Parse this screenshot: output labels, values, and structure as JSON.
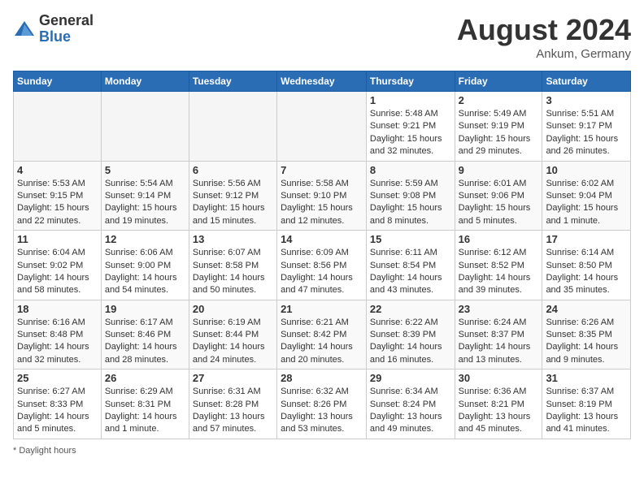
{
  "header": {
    "logo_general": "General",
    "logo_blue": "Blue",
    "month_title": "August 2024",
    "location": "Ankum, Germany"
  },
  "weekdays": [
    "Sunday",
    "Monday",
    "Tuesday",
    "Wednesday",
    "Thursday",
    "Friday",
    "Saturday"
  ],
  "weeks": [
    [
      {
        "day": "",
        "empty": true
      },
      {
        "day": "",
        "empty": true
      },
      {
        "day": "",
        "empty": true
      },
      {
        "day": "",
        "empty": true
      },
      {
        "day": "1",
        "sunrise": "5:48 AM",
        "sunset": "9:21 PM",
        "daylight": "15 hours and 32 minutes."
      },
      {
        "day": "2",
        "sunrise": "5:49 AM",
        "sunset": "9:19 PM",
        "daylight": "15 hours and 29 minutes."
      },
      {
        "day": "3",
        "sunrise": "5:51 AM",
        "sunset": "9:17 PM",
        "daylight": "15 hours and 26 minutes."
      }
    ],
    [
      {
        "day": "4",
        "sunrise": "5:53 AM",
        "sunset": "9:15 PM",
        "daylight": "15 hours and 22 minutes."
      },
      {
        "day": "5",
        "sunrise": "5:54 AM",
        "sunset": "9:14 PM",
        "daylight": "15 hours and 19 minutes."
      },
      {
        "day": "6",
        "sunrise": "5:56 AM",
        "sunset": "9:12 PM",
        "daylight": "15 hours and 15 minutes."
      },
      {
        "day": "7",
        "sunrise": "5:58 AM",
        "sunset": "9:10 PM",
        "daylight": "15 hours and 12 minutes."
      },
      {
        "day": "8",
        "sunrise": "5:59 AM",
        "sunset": "9:08 PM",
        "daylight": "15 hours and 8 minutes."
      },
      {
        "day": "9",
        "sunrise": "6:01 AM",
        "sunset": "9:06 PM",
        "daylight": "15 hours and 5 minutes."
      },
      {
        "day": "10",
        "sunrise": "6:02 AM",
        "sunset": "9:04 PM",
        "daylight": "15 hours and 1 minute."
      }
    ],
    [
      {
        "day": "11",
        "sunrise": "6:04 AM",
        "sunset": "9:02 PM",
        "daylight": "14 hours and 58 minutes."
      },
      {
        "day": "12",
        "sunrise": "6:06 AM",
        "sunset": "9:00 PM",
        "daylight": "14 hours and 54 minutes."
      },
      {
        "day": "13",
        "sunrise": "6:07 AM",
        "sunset": "8:58 PM",
        "daylight": "14 hours and 50 minutes."
      },
      {
        "day": "14",
        "sunrise": "6:09 AM",
        "sunset": "8:56 PM",
        "daylight": "14 hours and 47 minutes."
      },
      {
        "day": "15",
        "sunrise": "6:11 AM",
        "sunset": "8:54 PM",
        "daylight": "14 hours and 43 minutes."
      },
      {
        "day": "16",
        "sunrise": "6:12 AM",
        "sunset": "8:52 PM",
        "daylight": "14 hours and 39 minutes."
      },
      {
        "day": "17",
        "sunrise": "6:14 AM",
        "sunset": "8:50 PM",
        "daylight": "14 hours and 35 minutes."
      }
    ],
    [
      {
        "day": "18",
        "sunrise": "6:16 AM",
        "sunset": "8:48 PM",
        "daylight": "14 hours and 32 minutes."
      },
      {
        "day": "19",
        "sunrise": "6:17 AM",
        "sunset": "8:46 PM",
        "daylight": "14 hours and 28 minutes."
      },
      {
        "day": "20",
        "sunrise": "6:19 AM",
        "sunset": "8:44 PM",
        "daylight": "14 hours and 24 minutes."
      },
      {
        "day": "21",
        "sunrise": "6:21 AM",
        "sunset": "8:42 PM",
        "daylight": "14 hours and 20 minutes."
      },
      {
        "day": "22",
        "sunrise": "6:22 AM",
        "sunset": "8:39 PM",
        "daylight": "14 hours and 16 minutes."
      },
      {
        "day": "23",
        "sunrise": "6:24 AM",
        "sunset": "8:37 PM",
        "daylight": "14 hours and 13 minutes."
      },
      {
        "day": "24",
        "sunrise": "6:26 AM",
        "sunset": "8:35 PM",
        "daylight": "14 hours and 9 minutes."
      }
    ],
    [
      {
        "day": "25",
        "sunrise": "6:27 AM",
        "sunset": "8:33 PM",
        "daylight": "14 hours and 5 minutes."
      },
      {
        "day": "26",
        "sunrise": "6:29 AM",
        "sunset": "8:31 PM",
        "daylight": "14 hours and 1 minute."
      },
      {
        "day": "27",
        "sunrise": "6:31 AM",
        "sunset": "8:28 PM",
        "daylight": "13 hours and 57 minutes."
      },
      {
        "day": "28",
        "sunrise": "6:32 AM",
        "sunset": "8:26 PM",
        "daylight": "13 hours and 53 minutes."
      },
      {
        "day": "29",
        "sunrise": "6:34 AM",
        "sunset": "8:24 PM",
        "daylight": "13 hours and 49 minutes."
      },
      {
        "day": "30",
        "sunrise": "6:36 AM",
        "sunset": "8:21 PM",
        "daylight": "13 hours and 45 minutes."
      },
      {
        "day": "31",
        "sunrise": "6:37 AM",
        "sunset": "8:19 PM",
        "daylight": "13 hours and 41 minutes."
      }
    ]
  ],
  "footer": {
    "note": "Daylight hours"
  }
}
